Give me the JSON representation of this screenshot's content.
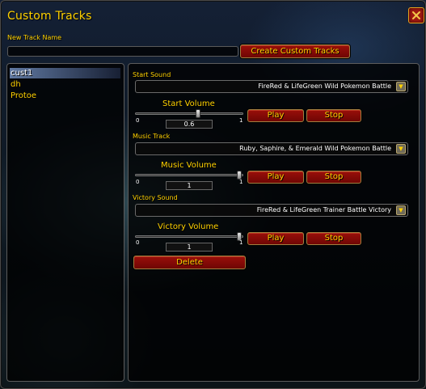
{
  "window": {
    "title": "Custom Tracks"
  },
  "new_track": {
    "label": "New Track Name",
    "value": "",
    "create_button": "Create Custom Tracks"
  },
  "track_list": {
    "items": [
      {
        "label": "cust1",
        "selected": true
      },
      {
        "label": "dh",
        "selected": false
      },
      {
        "label": "Protoe",
        "selected": false
      }
    ]
  },
  "start": {
    "sound_label": "Start Sound",
    "sound_value": "FireRed & LifeGreen Wild Pokemon Battle",
    "volume_label": "Start Volume",
    "volume_value": "0.6",
    "volume_level": 0.6,
    "min": "0",
    "max": "1",
    "play": "Play",
    "stop": "Stop"
  },
  "music": {
    "track_label": "Music Track",
    "track_value": "Ruby, Saphire, & Emerald Wild Pokemon Battle",
    "volume_label": "Music Volume",
    "volume_value": "1",
    "volume_level": 1,
    "min": "0",
    "max": "1",
    "play": "Play",
    "stop": "Stop"
  },
  "victory": {
    "sound_label": "Victory Sound",
    "sound_value": "FireRed & LifeGreen Trainer Battle Victory",
    "volume_label": "Victory Volume",
    "volume_value": "1",
    "volume_level": 1,
    "min": "0",
    "max": "1",
    "play": "Play",
    "stop": "Stop"
  },
  "delete_button": "Delete",
  "colors": {
    "gold_text": "#ffd100",
    "button_red": "#8a0a06",
    "close_red": "#a31a12"
  }
}
